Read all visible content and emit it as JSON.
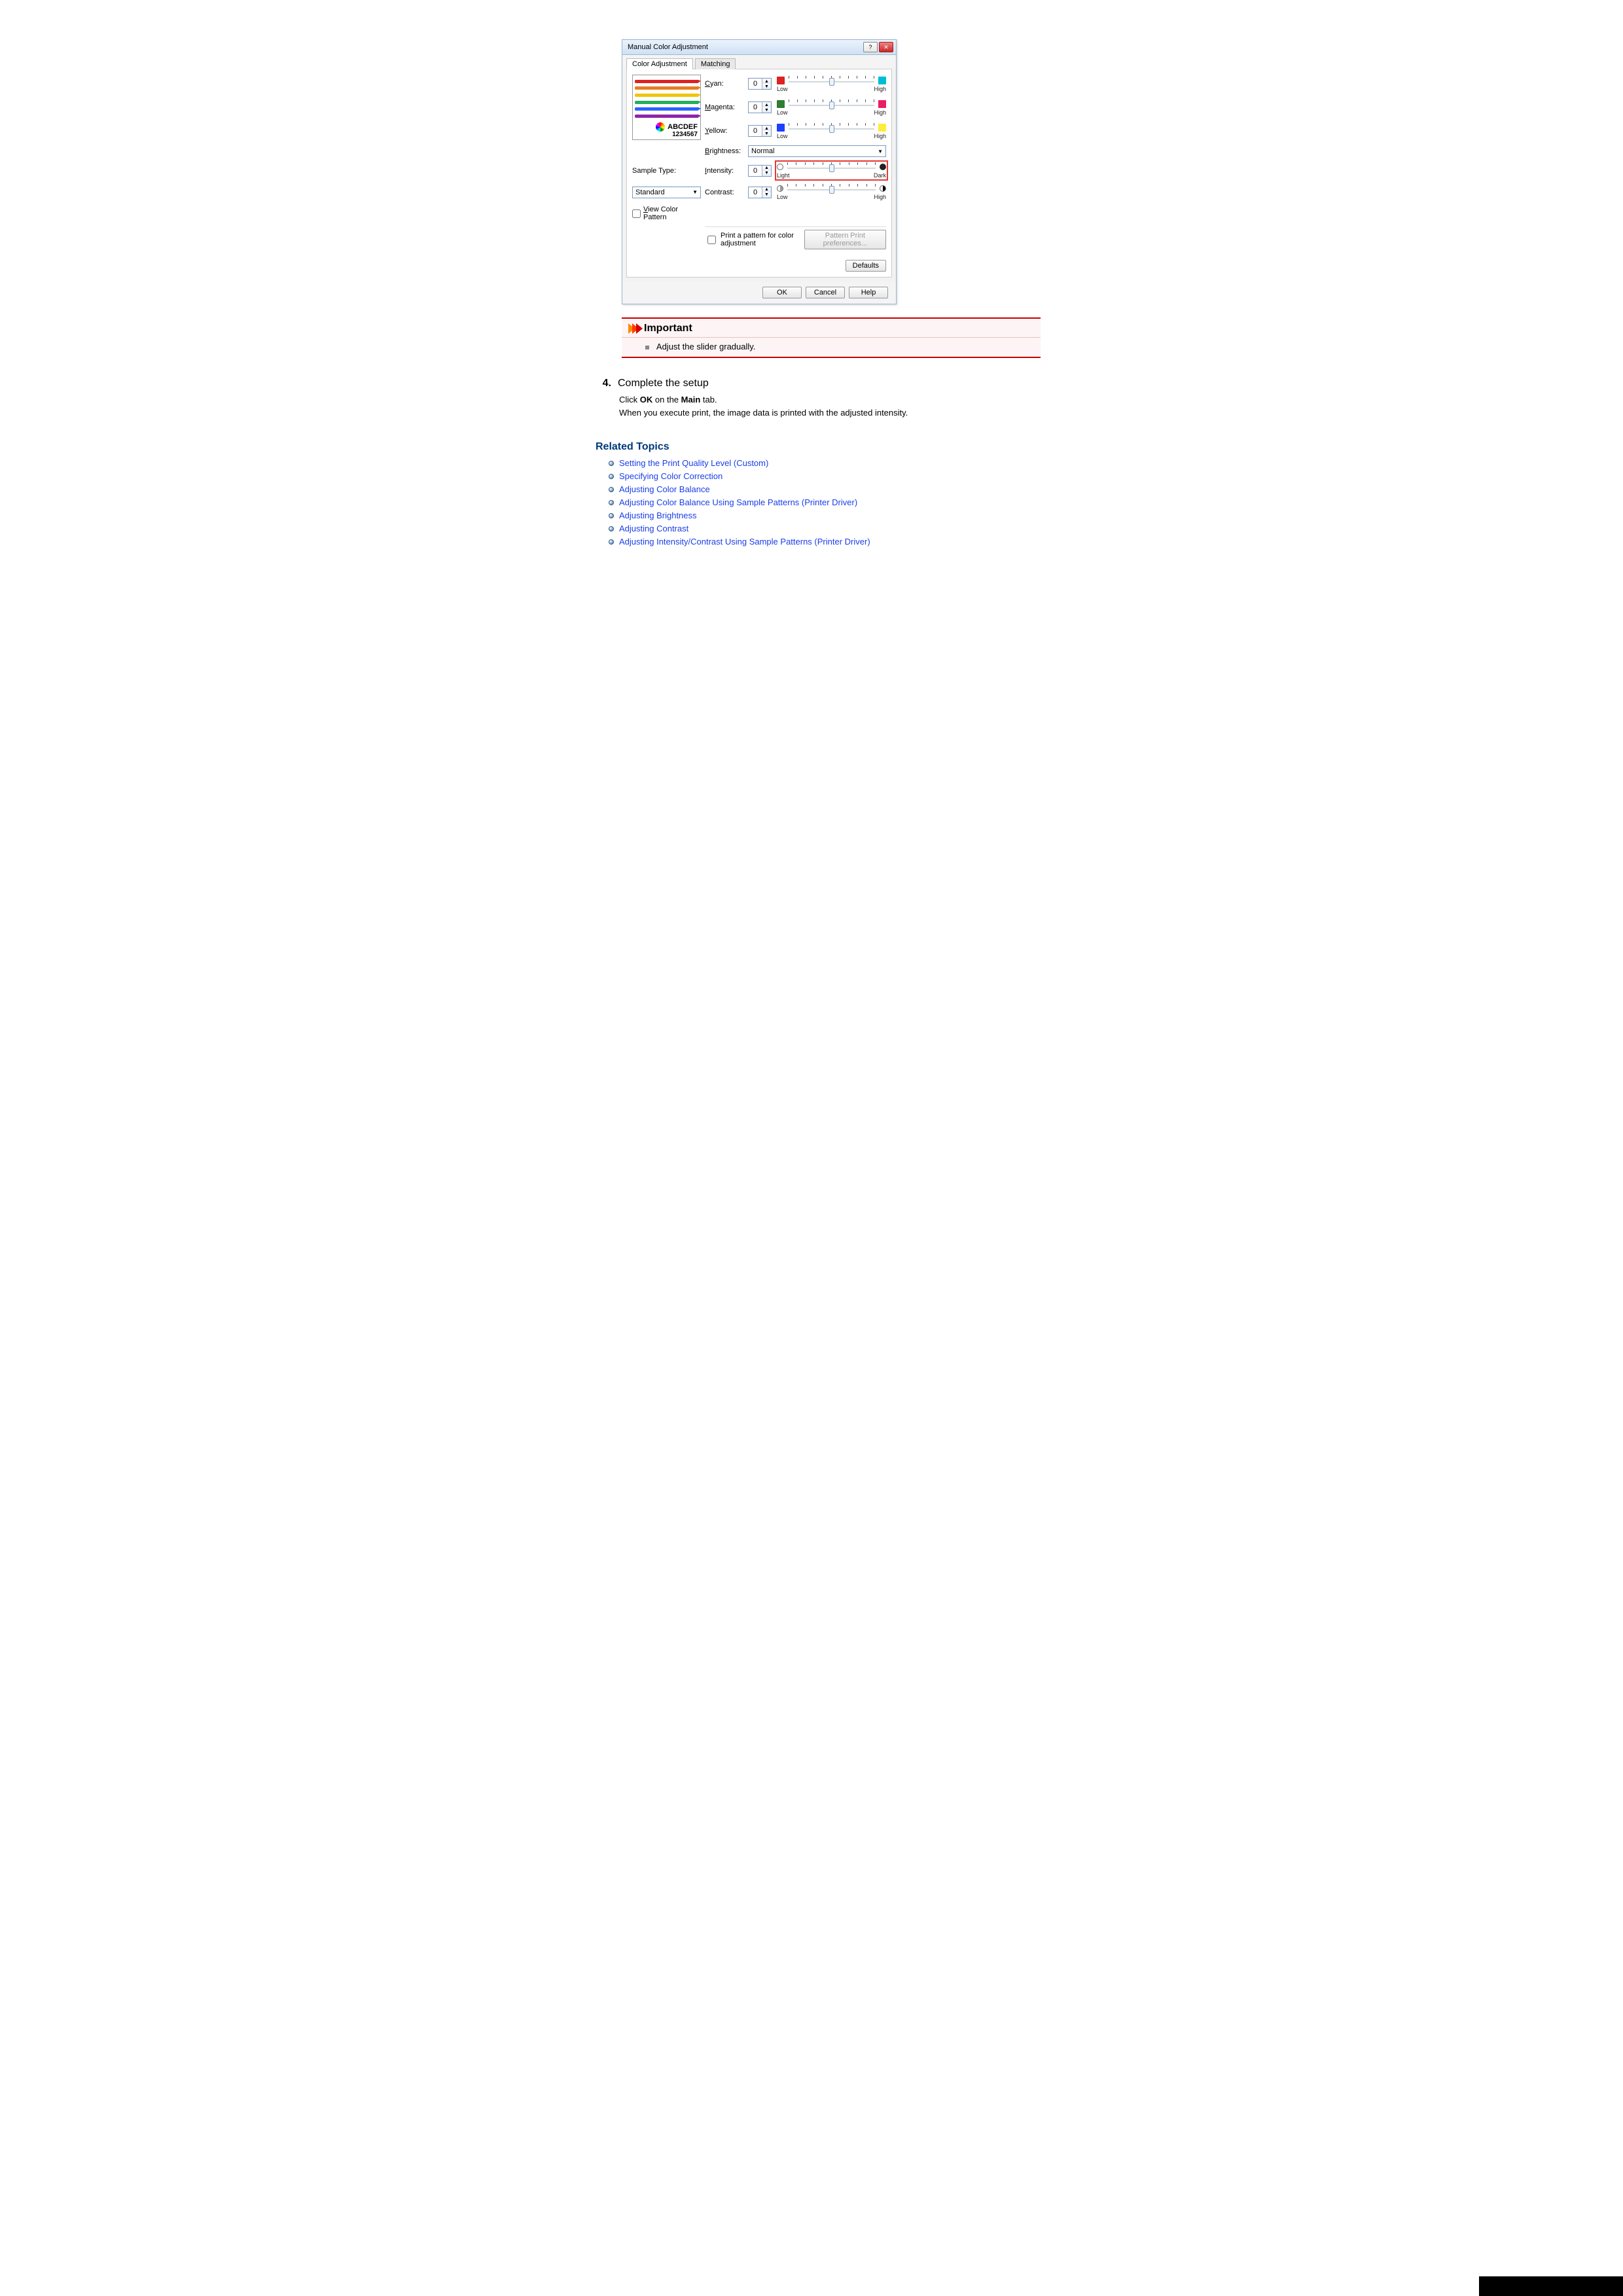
{
  "dialog": {
    "title": "Manual Color Adjustment",
    "tabs": {
      "active": "Color Adjustment",
      "inactive": "Matching"
    },
    "preview": {
      "line1": "ABCDEF",
      "line2": "1234567"
    },
    "labels": {
      "cyan": "Cyan:",
      "magenta": "Magenta:",
      "yellow": "Yellow:",
      "brightness": "Brightness:",
      "sample_type": "Sample Type:",
      "intensity": "Intensity:",
      "contrast": "Contrast:",
      "view_pattern": "View Color Pattern",
      "print_pattern": "Print a pattern for color adjustment"
    },
    "values": {
      "cyan": "0",
      "magenta": "0",
      "yellow": "0",
      "intensity": "0",
      "contrast": "0",
      "brightness": "Normal",
      "sample_type": "Standard"
    },
    "slider_labels": {
      "low": "Low",
      "high": "High",
      "light": "Light",
      "dark": "Dark"
    },
    "buttons": {
      "pattern_prefs": "Pattern Print preferences...",
      "defaults": "Defaults",
      "ok": "OK",
      "cancel": "Cancel",
      "help": "Help"
    }
  },
  "important": {
    "heading": "Important",
    "text": "Adjust the slider gradually."
  },
  "step": {
    "number": "4.",
    "title": "Complete the setup",
    "body_prefix": "Click ",
    "ok": "OK",
    "body_mid": " on the ",
    "main": "Main",
    "body_suffix": " tab.",
    "body_line2": "When you execute print, the image data is printed with the adjusted intensity."
  },
  "related": {
    "heading": "Related Topics",
    "links": [
      "Setting the Print Quality Level (Custom)",
      "Specifying Color Correction",
      "Adjusting Color Balance",
      "Adjusting Color Balance Using Sample Patterns (Printer Driver)",
      "Adjusting Brightness",
      "Adjusting Contrast",
      "Adjusting Intensity/Contrast Using Sample Patterns (Printer Driver)"
    ]
  }
}
